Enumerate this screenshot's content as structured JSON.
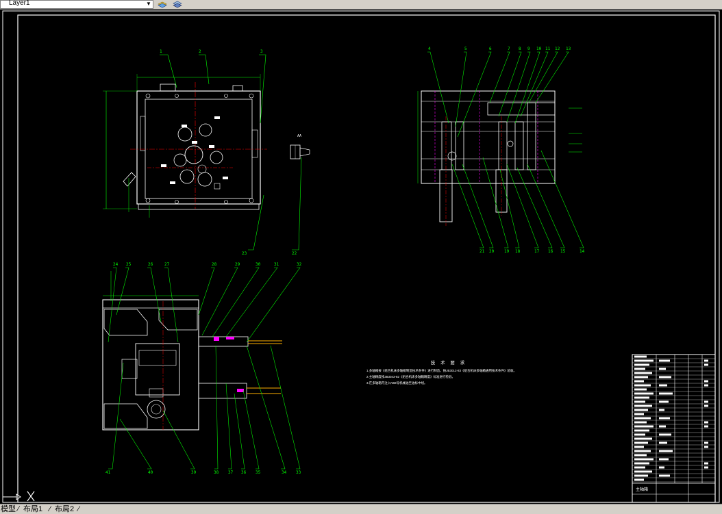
{
  "toolbar": {
    "layer_name": "Layer1",
    "layer_icon": "layer-stack-icon",
    "layer_prev_icon": "layer-previous-icon"
  },
  "tabs": {
    "model": "模型",
    "layout1": "布局1",
    "layout2": "布局2"
  },
  "drawing": {
    "label_a": "AA",
    "section_mark": "AA",
    "callouts_view1": [
      "1",
      "2",
      "3"
    ],
    "callouts_view1_bottom": [
      "23",
      "22"
    ],
    "callouts_view2_top": [
      "4",
      "5",
      "6",
      "7",
      "8",
      "9",
      "10",
      "11",
      "12",
      "13"
    ],
    "callouts_view2_bottom": [
      "21",
      "20",
      "19",
      "18",
      "17",
      "16",
      "15",
      "14"
    ],
    "callouts_view3_top": [
      "24",
      "25",
      "26",
      "27",
      "28",
      "29",
      "30",
      "31",
      "32"
    ],
    "callouts_view3_bottom": [
      "41",
      "40",
      "39",
      "38",
      "37",
      "36",
      "35",
      "34",
      "33"
    ],
    "notes_title": "技 术 要 求",
    "notes": [
      "1.多轴箱按《组合机床多轴箱制造技术条件》进行制造，按JB3012-83《组合机床多轴箱通用技术条件》验收。",
      "2.主轴精度按JB3043-82《组合机床多轴箱精度》标准进行检验。",
      "3.在多轴箱内注入N68号机械油至油标中线。"
    ],
    "titleblock_label": "主轴箱"
  },
  "colors": {
    "background": "#000000",
    "line": "#ffffff",
    "leader": "#00ff00",
    "center": "#ff0000",
    "hidden": "#ff00ff",
    "dim": "#00ff00",
    "chrome": "#d4d0c8"
  }
}
